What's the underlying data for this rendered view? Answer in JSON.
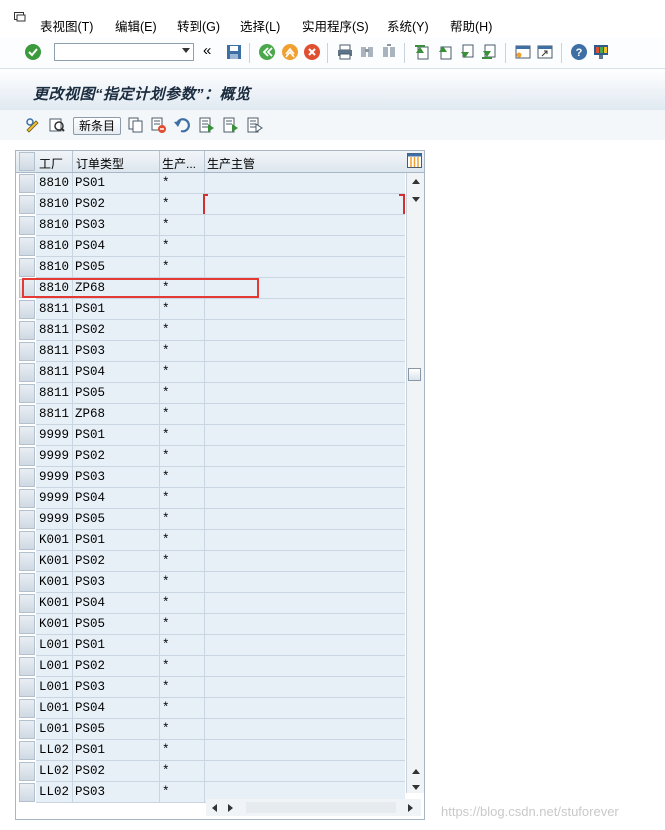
{
  "menubar": {
    "items": [
      "表视图(T)",
      "编辑(E)",
      "转到(G)",
      "选择(L)",
      "实用程序(S)",
      "系统(Y)",
      "帮助(H)"
    ]
  },
  "toolbar": {
    "command_value": "",
    "icons": [
      "enter-icon",
      "back-icon",
      "save-icon",
      "back-green-icon",
      "exit-icon",
      "cancel-icon",
      "print-icon",
      "find-icon",
      "find-next-icon",
      "first-page-icon",
      "previous-page-icon",
      "next-page-icon",
      "last-page-icon",
      "create-session-icon",
      "shortcut-icon",
      "help-icon",
      "customize-layout-icon"
    ]
  },
  "title": "更改视图“指定计划参数”：概览",
  "app_toolbar": {
    "new_entries_label": "新条目"
  },
  "table": {
    "columns": [
      "工厂",
      "订单类型",
      "生产...",
      "生产主管"
    ],
    "rows": [
      [
        "8810",
        "PS01",
        "*",
        ""
      ],
      [
        "8810",
        "PS02",
        "*",
        ""
      ],
      [
        "8810",
        "PS03",
        "*",
        ""
      ],
      [
        "8810",
        "PS04",
        "*",
        ""
      ],
      [
        "8810",
        "PS05",
        "*",
        ""
      ],
      [
        "8810",
        "ZP68",
        "*",
        ""
      ],
      [
        "8811",
        "PS01",
        "*",
        ""
      ],
      [
        "8811",
        "PS02",
        "*",
        ""
      ],
      [
        "8811",
        "PS03",
        "*",
        ""
      ],
      [
        "8811",
        "PS04",
        "*",
        ""
      ],
      [
        "8811",
        "PS05",
        "*",
        ""
      ],
      [
        "8811",
        "ZP68",
        "*",
        ""
      ],
      [
        "9999",
        "PS01",
        "*",
        ""
      ],
      [
        "9999",
        "PS02",
        "*",
        ""
      ],
      [
        "9999",
        "PS03",
        "*",
        ""
      ],
      [
        "9999",
        "PS04",
        "*",
        ""
      ],
      [
        "9999",
        "PS05",
        "*",
        ""
      ],
      [
        "K001",
        "PS01",
        "*",
        ""
      ],
      [
        "K001",
        "PS02",
        "*",
        ""
      ],
      [
        "K001",
        "PS03",
        "*",
        ""
      ],
      [
        "K001",
        "PS04",
        "*",
        ""
      ],
      [
        "K001",
        "PS05",
        "*",
        ""
      ],
      [
        "L001",
        "PS01",
        "*",
        ""
      ],
      [
        "L001",
        "PS02",
        "*",
        ""
      ],
      [
        "L001",
        "PS03",
        "*",
        ""
      ],
      [
        "L001",
        "PS04",
        "*",
        ""
      ],
      [
        "L001",
        "PS05",
        "*",
        ""
      ],
      [
        "LL02",
        "PS01",
        "*",
        ""
      ],
      [
        "LL02",
        "PS02",
        "*",
        ""
      ],
      [
        "LL02",
        "PS03",
        "*",
        ""
      ]
    ],
    "highlighted_row": 5
  },
  "watermark": "https://blog.csdn.net/stuforever",
  "colors": {
    "row_bg": "#e8f0f7",
    "title_text": "#1b2c3f",
    "highlight": "#e53935"
  }
}
